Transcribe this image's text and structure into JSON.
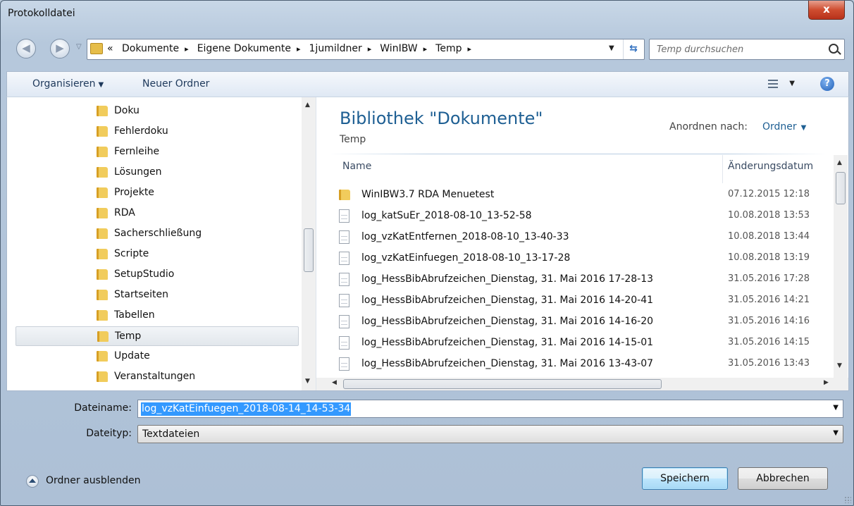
{
  "window": {
    "title": "Protokolldatei",
    "close_label": "x"
  },
  "address": {
    "crumbs": [
      "Dokumente",
      "Eigene Dokumente",
      "1jumildner",
      "WinIBW",
      "Temp"
    ],
    "prefix": "«",
    "separator": "▸"
  },
  "search": {
    "placeholder": "Temp durchsuchen"
  },
  "toolbar": {
    "organize_label": "Organisieren",
    "new_folder_label": "Neuer Ordner",
    "help_label": "?"
  },
  "nav": {
    "items": [
      {
        "label": "Doku"
      },
      {
        "label": "Fehlerdoku"
      },
      {
        "label": "Fernleihe"
      },
      {
        "label": "Lösungen"
      },
      {
        "label": "Projekte"
      },
      {
        "label": "RDA"
      },
      {
        "label": "Sacherschließung"
      },
      {
        "label": "Scripte"
      },
      {
        "label": "SetupStudio"
      },
      {
        "label": "Startseiten"
      },
      {
        "label": "Tabellen"
      },
      {
        "label": "Temp",
        "selected": true
      },
      {
        "label": "Update"
      },
      {
        "label": "Veranstaltungen"
      }
    ]
  },
  "library": {
    "title": "Bibliothek \"Dokumente\"",
    "subtitle": "Temp",
    "arrange_label": "Anordnen nach:",
    "arrange_value": "Ordner"
  },
  "columns": {
    "name": "Name",
    "date": "Änderungsdatum"
  },
  "files": [
    {
      "name": "WinIBW3.7 RDA Menuetest",
      "date": "07.12.2015 12:18",
      "type": "folder"
    },
    {
      "name": "log_katSuEr_2018-08-10_13-52-58",
      "date": "10.08.2018 13:53",
      "type": "file"
    },
    {
      "name": "log_vzKatEntfernen_2018-08-10_13-40-33",
      "date": "10.08.2018 13:44",
      "type": "file"
    },
    {
      "name": "log_vzKatEinfuegen_2018-08-10_13-17-28",
      "date": "10.08.2018 13:19",
      "type": "file"
    },
    {
      "name": "log_HessBibAbrufzeichen_Dienstag, 31. Mai 2016 17-28-13",
      "date": "31.05.2016 17:28",
      "type": "file"
    },
    {
      "name": "log_HessBibAbrufzeichen_Dienstag, 31. Mai 2016 14-20-41",
      "date": "31.05.2016 14:21",
      "type": "file"
    },
    {
      "name": "log_HessBibAbrufzeichen_Dienstag, 31. Mai 2016 14-16-20",
      "date": "31.05.2016 14:16",
      "type": "file"
    },
    {
      "name": "log_HessBibAbrufzeichen_Dienstag, 31. Mai 2016 14-15-01",
      "date": "31.05.2016 14:15",
      "type": "file"
    },
    {
      "name": "log_HessBibAbrufzeichen_Dienstag, 31. Mai 2016 13-43-07",
      "date": "31.05.2016 13:43",
      "type": "file"
    }
  ],
  "form": {
    "filename_label": "Dateiname:",
    "filename_value": "log_vzKatEinfuegen_2018-08-14_14-53-34",
    "filetype_label": "Dateityp:",
    "filetype_value": "Textdateien"
  },
  "footer": {
    "hide_folders_label": "Ordner ausblenden",
    "save_label": "Speichern",
    "cancel_label": "Abbrechen"
  },
  "colors": {
    "accent": "#1e5f93",
    "selection": "#3399ff"
  }
}
